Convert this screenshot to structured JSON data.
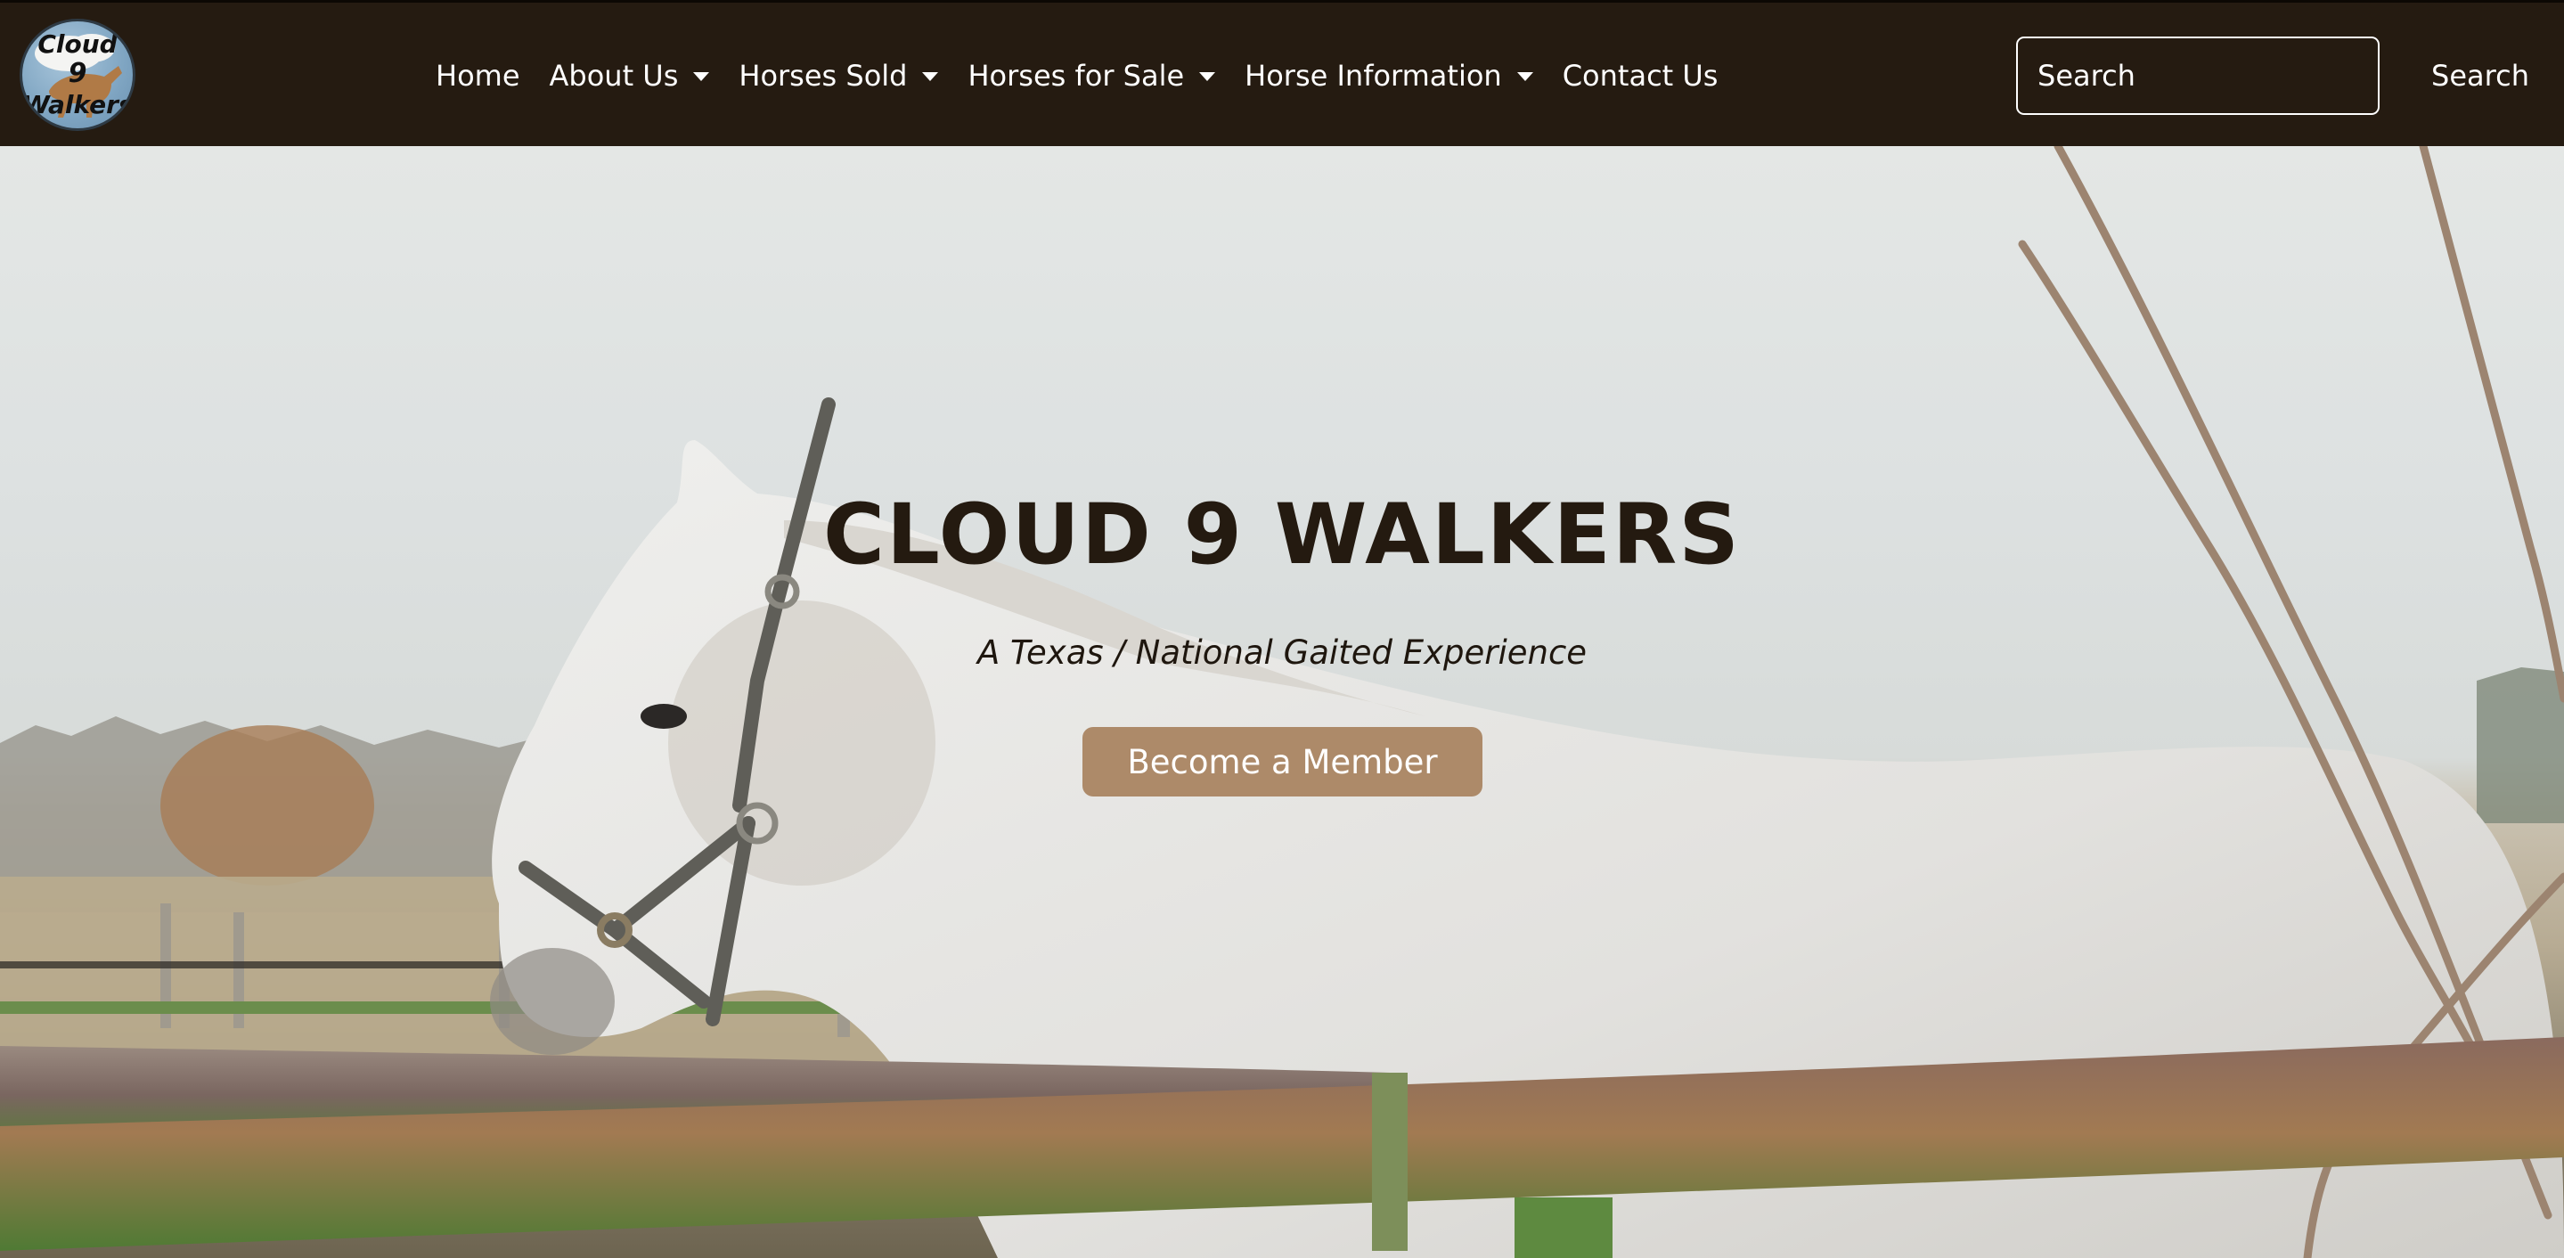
{
  "brand": {
    "logo_line1": "Cloud",
    "logo_line2": "9",
    "logo_line3": "Walkers"
  },
  "nav": {
    "items": [
      {
        "label": "Home",
        "dropdown": false
      },
      {
        "label": "About Us",
        "dropdown": true
      },
      {
        "label": "Horses Sold",
        "dropdown": true
      },
      {
        "label": "Horses for Sale",
        "dropdown": true
      },
      {
        "label": "Horse Information",
        "dropdown": true
      },
      {
        "label": "Contact Us",
        "dropdown": false
      }
    ]
  },
  "search": {
    "placeholder": "Search",
    "button_label": "Search"
  },
  "hero": {
    "title": "CLOUD 9 WALKERS",
    "subtitle": "A Texas / National Gaited Experience",
    "cta_label": "Become a Member"
  },
  "colors": {
    "navbar_bg": "#251b11",
    "cta_bg": "#ad8a69",
    "title_text": "#241a10"
  }
}
